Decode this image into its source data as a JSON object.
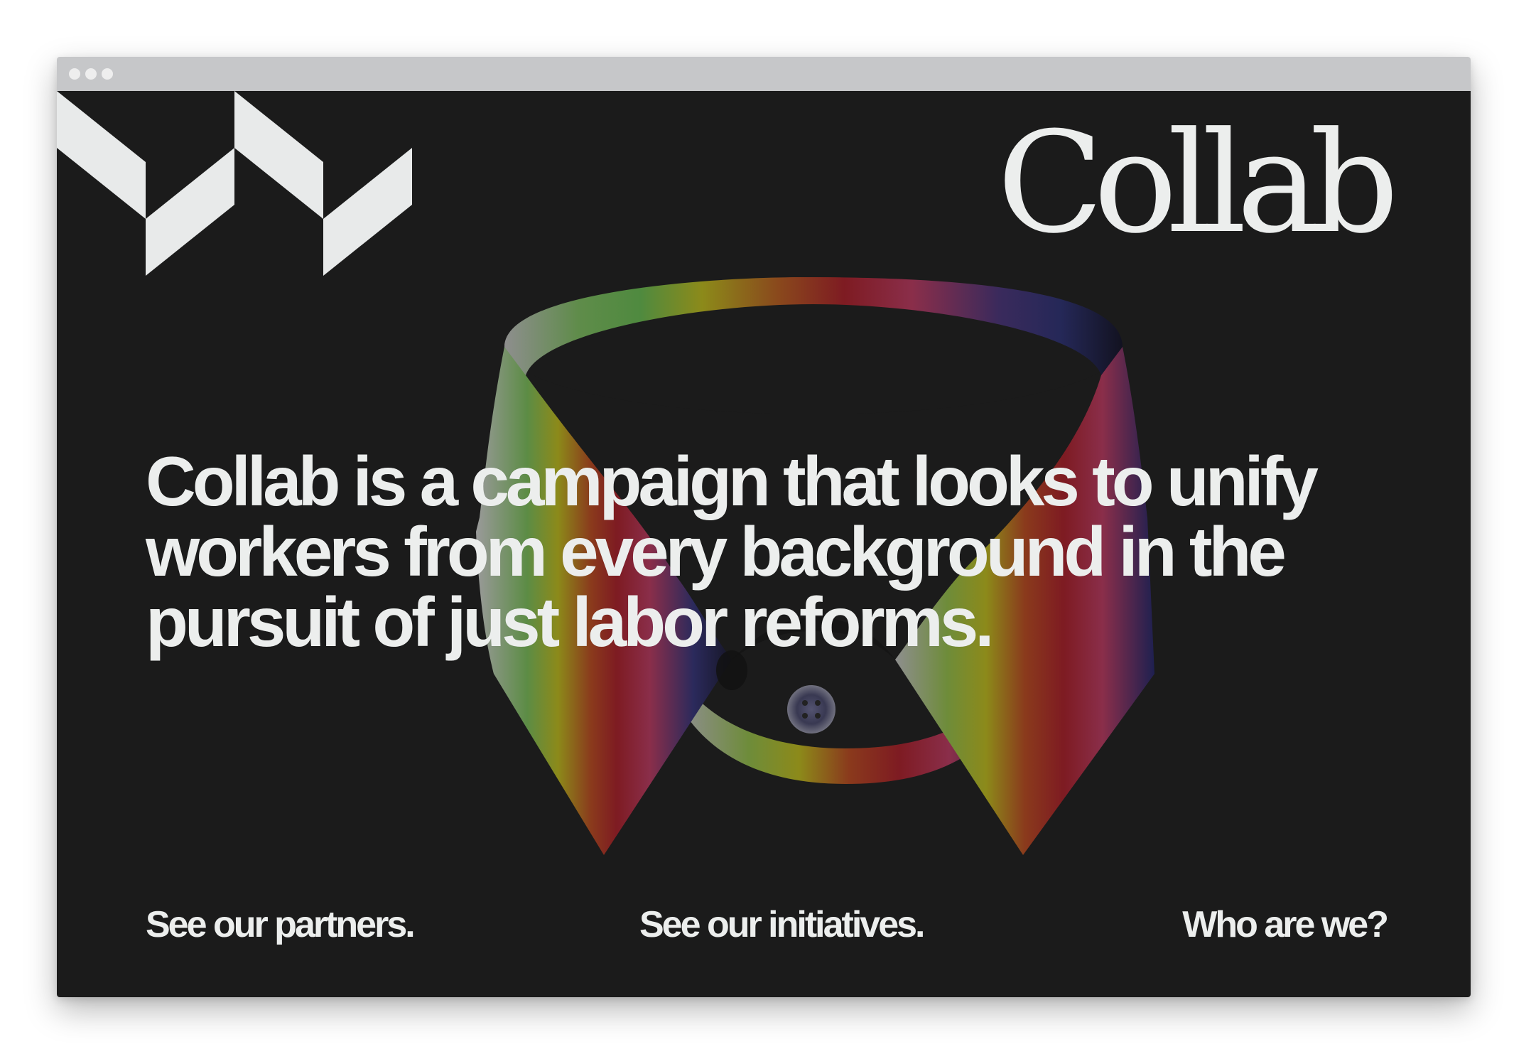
{
  "browser": {
    "window_controls": [
      "close",
      "minimize",
      "maximize"
    ]
  },
  "site": {
    "logo_icon": "chevron-zigzag-mark-icon",
    "wordmark": "Collab",
    "hero_image": "rainbow-shirt-collar-illustration",
    "headline": "Collab is a campaign that looks to unify workers from every background in the pursuit of just labor reforms.",
    "nav": [
      {
        "label": "See our partners."
      },
      {
        "label": "See our initiatives."
      },
      {
        "label": "Who are we?"
      }
    ]
  },
  "colors": {
    "background": "#1b1b1b",
    "text": "#eceeed",
    "titlebar": "#c6c7c9",
    "collar_gradient": [
      "#8a8a8a",
      "#4f8a3f",
      "#8c8a1a",
      "#8a3a1c",
      "#7e1b22",
      "#8a2e4a",
      "#2b2a5c",
      "#161626"
    ]
  }
}
